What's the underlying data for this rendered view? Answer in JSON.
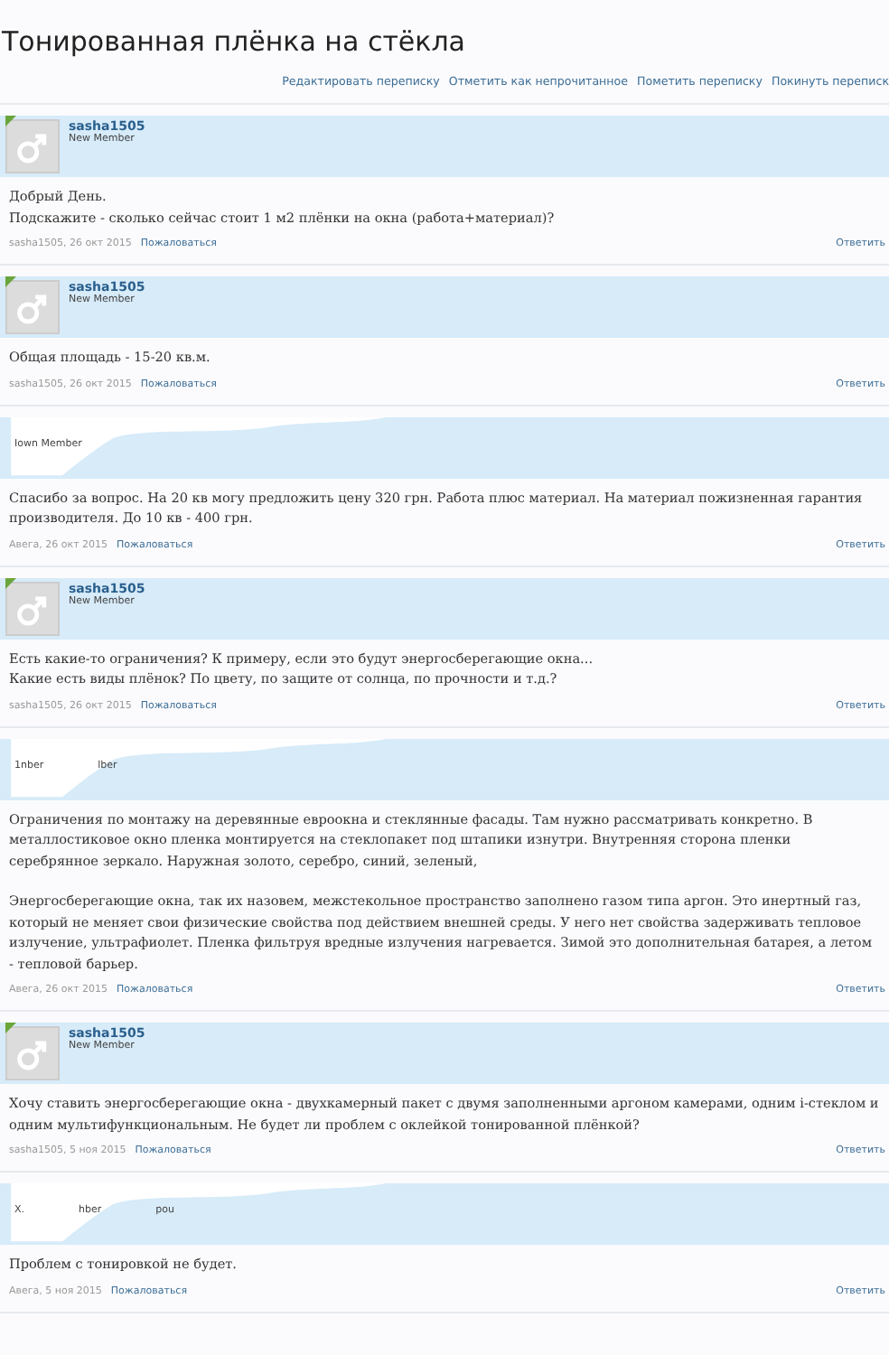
{
  "thread": {
    "title": "Тонированная плёнка на стёкла"
  },
  "thread_actions": [
    "Редактировать переписку",
    "Отметить как непрочитанное",
    "Пометить переписку",
    "Покинуть переписк"
  ],
  "posts": [
    {
      "kind": "member",
      "author": "sasha1505",
      "role": "New Member",
      "online": true,
      "paragraphs": [
        "Добрый День.\nПодскажите - сколько сейчас стоит 1 м2 плёнки на окна (работа+материал)?"
      ],
      "meta": "sasha1505, 26 окт 2015",
      "report": "Пожаловаться",
      "reply": "Ответить"
    },
    {
      "kind": "member",
      "author": "sasha1505",
      "role": "New Member",
      "online": true,
      "paragraphs": [
        "Общая площадь - 15-20 кв.м."
      ],
      "meta": "sasha1505, 26 окт 2015",
      "report": "Пожаловаться",
      "reply": "Ответить"
    },
    {
      "kind": "obscured",
      "fragments": [
        "Iown Member"
      ],
      "paragraphs": [
        "Спасибо за вопрос. На 20 кв могу предложить цену 320 грн. Работа плюс материал. На материал пожизненная гарантия производителя. До 10 кв - 400 грн."
      ],
      "meta": "Авега, 26 окт 2015",
      "report": "Пожаловаться",
      "reply": "Ответить"
    },
    {
      "kind": "member",
      "author": "sasha1505",
      "role": "New Member",
      "online": true,
      "paragraphs": [
        "Есть какие-то ограничения? К примеру, если это будут энергосберегающие окна...\nКакие есть виды плёнок? По цвету, по защите от солнца, по прочности и т.д.?"
      ],
      "meta": "sasha1505, 26 окт 2015",
      "report": "Пожаловаться",
      "reply": "Ответить"
    },
    {
      "kind": "obscured",
      "fragments": [
        "1nber",
        "lber"
      ],
      "paragraphs": [
        "Ограничения по монтажу на деревянные евроокна и стеклянные фасады. Там нужно рассматривать конкретно. В металлостиковое окно пленка монтируется на стеклопакет под штапики изнутри. Внутренняя сторона пленки серебрянное зеркало. Наружная золото, серебро, синий, зеленый,",
        "Энергосберегающие окна, так их назовем, межстекольное пространство заполнено газом типа аргон. Это инертный газ, который не меняет свои физические свойства под действием внешней среды. У него нет свойства задерживать тепловое излучение, ультрафиолет. Пленка фильтруя вредные излучения нагревается. Зимой это дополнительная батарея, а летом - тепловой барьер."
      ],
      "meta": "Авега, 26 окт 2015",
      "report": "Пожаловаться",
      "reply": "Ответить"
    },
    {
      "kind": "member",
      "author": "sasha1505",
      "role": "New Member",
      "online": true,
      "paragraphs": [
        "Хочу ставить энергосберегающие окна - двухкамерный пакет с двумя заполненными аргоном камерами, одним i-стеклом и одним мультифункциональным. Не будет ли проблем с оклейкой тонированной плёнкой?"
      ],
      "meta": "sasha1505, 5 ноя 2015",
      "report": "Пожаловаться",
      "reply": "Ответить"
    },
    {
      "kind": "obscured",
      "fragments": [
        "X.",
        "hber",
        "pou"
      ],
      "paragraphs": [
        "Проблем с тонировкой не будет."
      ],
      "meta": "Авега, 5 ноя 2015",
      "report": "Пожаловаться",
      "reply": "Ответить"
    }
  ]
}
